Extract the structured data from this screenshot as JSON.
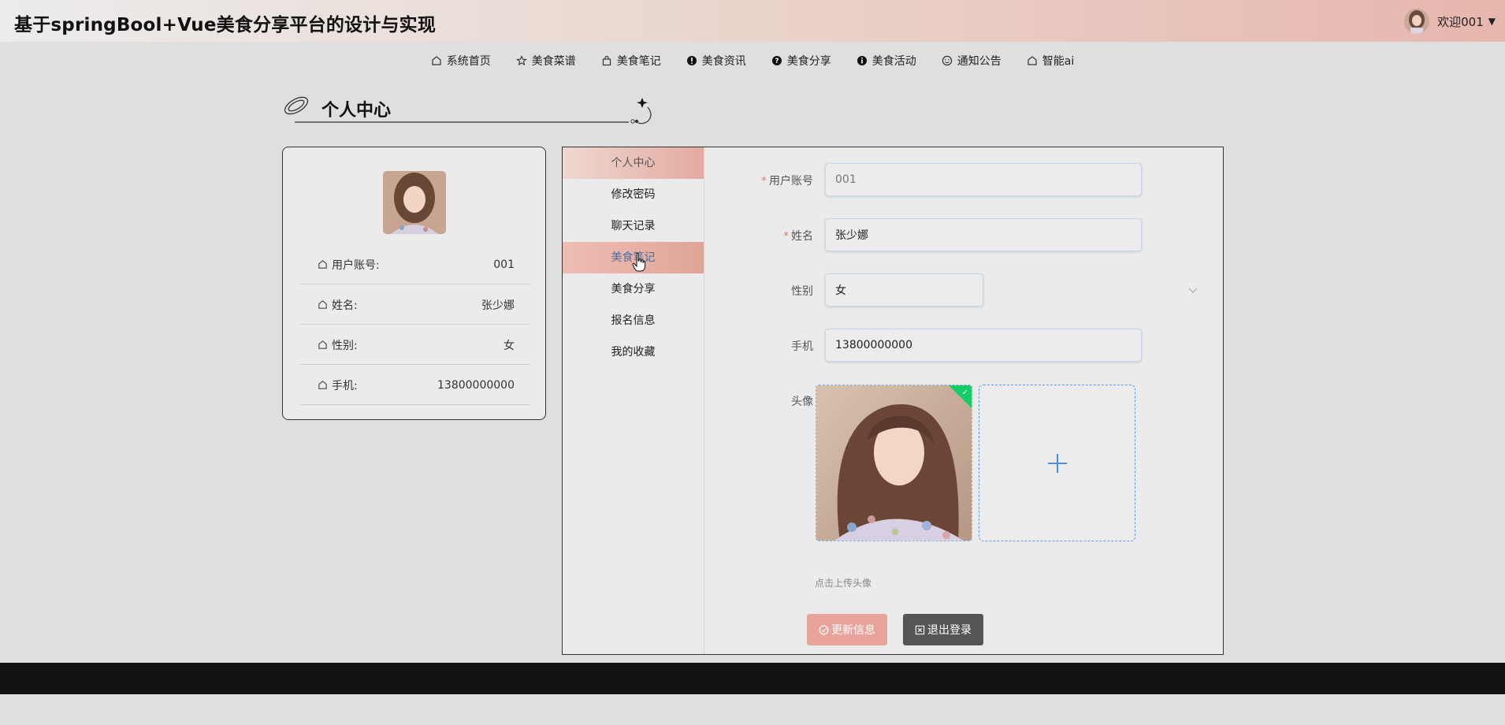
{
  "header": {
    "site_title": "基于springBool+Vue美食分享平台的设计与实现",
    "user_greeting": "欢迎001",
    "caret_icon": "caret-down-icon"
  },
  "nav": {
    "items": [
      {
        "label": "系统首页",
        "icon": "home-icon"
      },
      {
        "label": "美食菜谱",
        "icon": "star-icon"
      },
      {
        "label": "美食笔记",
        "icon": "bag-icon"
      },
      {
        "label": "美食资讯",
        "icon": "info-circle-icon"
      },
      {
        "label": "美食分享",
        "icon": "question-circle-icon"
      },
      {
        "label": "美食活动",
        "icon": "info-circle-icon"
      },
      {
        "label": "通知公告",
        "icon": "smile-icon"
      },
      {
        "label": "智能ai",
        "icon": "home-icon"
      }
    ]
  },
  "section": {
    "title": "个人中心"
  },
  "profile_card": {
    "rows": [
      {
        "label": "用户账号:",
        "value": "001"
      },
      {
        "label": "姓名:",
        "value": "张少娜"
      },
      {
        "label": "性别:",
        "value": "女"
      },
      {
        "label": "手机:",
        "value": "13800000000"
      }
    ]
  },
  "side_menu": {
    "items": [
      {
        "label": "个人中心",
        "state": "active"
      },
      {
        "label": "修改密码",
        "state": "normal"
      },
      {
        "label": "聊天记录",
        "state": "normal"
      },
      {
        "label": "美食笔记",
        "state": "hover"
      },
      {
        "label": "美食分享",
        "state": "normal"
      },
      {
        "label": "报名信息",
        "state": "normal"
      },
      {
        "label": "我的收藏",
        "state": "normal"
      }
    ]
  },
  "form": {
    "required_mark": "*",
    "account": {
      "label": "用户账号",
      "value": "001"
    },
    "name": {
      "label": "姓名",
      "value": "张少娜"
    },
    "gender": {
      "label": "性别",
      "value": "女"
    },
    "phone": {
      "label": "手机",
      "value": "13800000000"
    },
    "avatar": {
      "label": "头像",
      "tip": "点击上传头像",
      "add_icon": "plus-icon"
    }
  },
  "buttons": {
    "update": "更新信息",
    "logout": "退出登录"
  },
  "colors": {
    "header_gradient_end": "#e7b6ad",
    "accent": "#e8a49b",
    "upload_success": "#13ce66",
    "footer": "#111111"
  }
}
